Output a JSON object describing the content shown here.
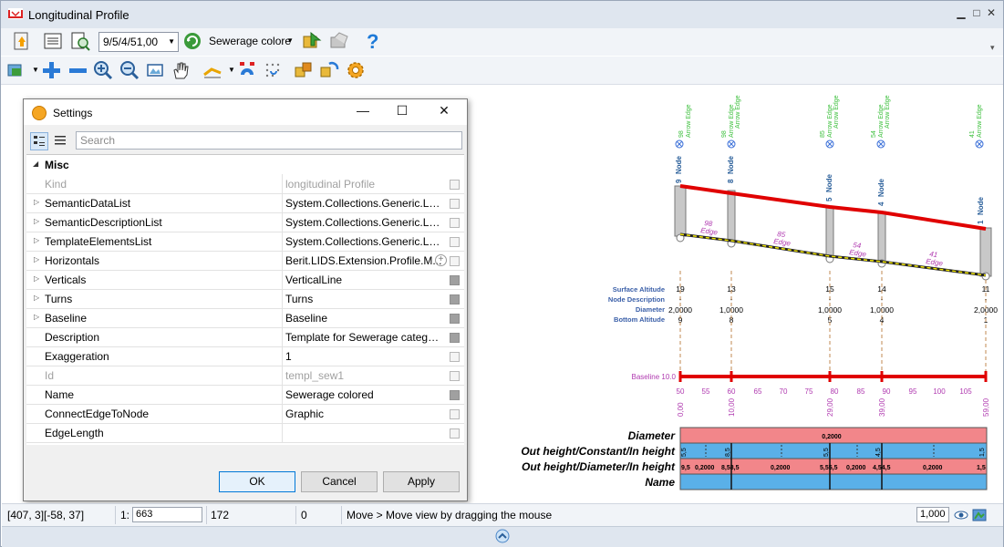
{
  "window": {
    "title": "Longitudinal Profile"
  },
  "toolbar": {
    "version_combo": "9/5/4/51,00",
    "template_combo": "Sewerage colore"
  },
  "settings_dialog": {
    "title": "Settings",
    "search_placeholder": "Search",
    "category": "Misc",
    "rows": [
      {
        "name": "Kind",
        "value": "longitudinal Profile",
        "expandable": false,
        "readonly": true
      },
      {
        "name": "SemanticDataList",
        "value": "System.Collections.Generic.List`...",
        "expandable": true,
        "readonly": false
      },
      {
        "name": "SemanticDescriptionList",
        "value": "System.Collections.Generic.List`...",
        "expandable": true,
        "readonly": false
      },
      {
        "name": "TemplateElementsList",
        "value": "System.Collections.Generic.List`...",
        "expandable": true,
        "readonly": false
      },
      {
        "name": "Horizontals",
        "value": "Berit.LIDS.Extension.Profile.M...",
        "expandable": true,
        "readonly": false
      },
      {
        "name": "Verticals",
        "value": "VerticalLine",
        "expandable": true,
        "readonly": false
      },
      {
        "name": "Turns",
        "value": "Turns",
        "expandable": true,
        "readonly": false
      },
      {
        "name": "Baseline",
        "value": "Baseline",
        "expandable": true,
        "readonly": false
      },
      {
        "name": "Description",
        "value": "Template for Sewerage category...",
        "expandable": false,
        "readonly": false
      },
      {
        "name": "Exaggeration",
        "value": "1",
        "expandable": false,
        "readonly": false
      },
      {
        "name": "Id",
        "value": "templ_sew1",
        "expandable": false,
        "readonly": true
      },
      {
        "name": "Name",
        "value": "Sewerage colored",
        "expandable": false,
        "readonly": false
      },
      {
        "name": "ConnectEdgeToNode",
        "value": "Graphic",
        "expandable": false,
        "readonly": false
      },
      {
        "name": "EdgeLength",
        "value": "",
        "expandable": false,
        "readonly": false
      }
    ],
    "buttons": {
      "ok": "OK",
      "cancel": "Cancel",
      "apply": "Apply"
    }
  },
  "profile": {
    "top_labels": [
      {
        "id": "98",
        "text": "Arrow Edge"
      },
      {
        "id": "98",
        "text": "Arrow Edge / Arrow Edge"
      },
      {
        "id": "85",
        "text": "Arrow Edge / Arrow Edge"
      },
      {
        "id": "54",
        "text": "Arrow Edge / Arrow Edge"
      },
      {
        "id": "41",
        "text": "Arrow Edge"
      }
    ],
    "nodes": [
      {
        "name": "Node",
        "id": "9",
        "surface_altitude": "19",
        "description": "-",
        "diameter": "2,0000",
        "bottom_altitude": "9",
        "station": "0,00"
      },
      {
        "name": "Node",
        "id": "8",
        "surface_altitude": "13",
        "description": "-",
        "diameter": "1,0000",
        "bottom_altitude": "8",
        "station": "10,00"
      },
      {
        "name": "Node",
        "id": "5",
        "surface_altitude": "15",
        "description": "-",
        "diameter": "1,0000",
        "bottom_altitude": "5",
        "station": "29,00"
      },
      {
        "name": "Node",
        "id": "4",
        "surface_altitude": "14",
        "description": "-",
        "diameter": "1,0000",
        "bottom_altitude": "4",
        "station": "39,00"
      },
      {
        "name": "Node",
        "id": "1",
        "surface_altitude": "11",
        "description": "-",
        "diameter": "2,0000",
        "bottom_altitude": "1",
        "station": "59,00"
      }
    ],
    "edges": [
      {
        "id": "98",
        "label": "Edge"
      },
      {
        "id": "85",
        "label": "Edge"
      },
      {
        "id": "54",
        "label": "Edge"
      },
      {
        "id": "41",
        "label": "Edge"
      }
    ],
    "row_labels": {
      "surface": "Surface Altitude",
      "description": "Node Description",
      "diameter": "Diameter",
      "bottom": "Bottom Altitude"
    },
    "baseline_label": "Baseline 10.0",
    "scale_ticks": [
      "50",
      "55",
      "60",
      "65",
      "70",
      "75",
      "80",
      "85",
      "90",
      "95",
      "100",
      "105"
    ],
    "table": {
      "headers": [
        "Diameter",
        "Out height/Constant/In height",
        "Out height/Diameter/In height",
        "Name"
      ],
      "diameter_value": "0,2000",
      "constant_values": [
        "5,5",
        "8,5",
        "5,5",
        "4,5",
        "1,5"
      ],
      "diameter_row_values": [
        "9,5",
        "0,2000",
        "8,58,5",
        "0,2000",
        "5,55,5",
        "0,2000",
        "4,54,5",
        "0,2000",
        "1,5"
      ]
    }
  },
  "statusbar": {
    "coords": "[407, 3][-58, 37]",
    "scale_label": "1:",
    "scale_value": "663",
    "value2": "172",
    "value3": "0",
    "message": "Move > Move view by dragging the mouse",
    "zoom_value": "1,000"
  }
}
